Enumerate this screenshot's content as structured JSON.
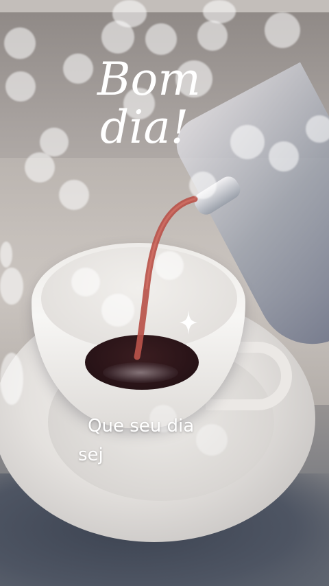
{
  "greeting": {
    "line1": "Bom",
    "line2": "dia!"
  },
  "message": {
    "line1": "Que seu dia",
    "line2": "sej"
  },
  "colors": {
    "text": "#ffffff",
    "coffee": "#2a1418",
    "pour_stream": "#b8524a"
  },
  "icons": [
    "sparkle-icon"
  ]
}
